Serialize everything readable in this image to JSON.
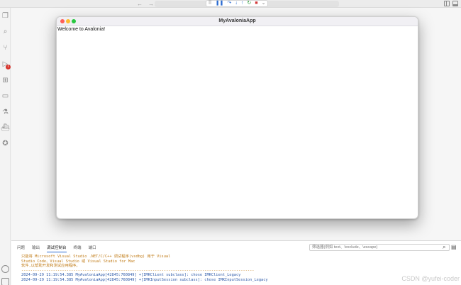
{
  "topbar": {
    "back_arrow": "←",
    "forward_arrow": "→",
    "debug_controls": [
      {
        "icon": "drag-handle-icon",
        "glyph": "⠿"
      },
      {
        "icon": "pause-icon",
        "glyph": "❚❚"
      },
      {
        "icon": "step-over-icon",
        "glyph": "↷"
      },
      {
        "icon": "step-into-icon",
        "glyph": "↓"
      },
      {
        "icon": "step-out-icon",
        "glyph": "↑"
      },
      {
        "icon": "restart-icon",
        "glyph": "↻"
      },
      {
        "icon": "stop-icon",
        "glyph": "■"
      },
      {
        "icon": "chevron-down-icon",
        "glyph": "⌄"
      }
    ]
  },
  "activity": [
    {
      "name": "explorer-icon",
      "glyph": "❐"
    },
    {
      "name": "search-icon",
      "glyph": "⌕"
    },
    {
      "name": "source-control-icon",
      "glyph": "⑂"
    },
    {
      "name": "run-debug-icon",
      "glyph": "▷",
      "badge": "1"
    },
    {
      "name": "extensions-icon",
      "glyph": "⊞"
    },
    {
      "name": "remote-explorer-icon",
      "glyph": "▭"
    },
    {
      "name": "testing-icon",
      "glyph": "⚗"
    },
    {
      "name": "docker-icon",
      "glyph": "⛴"
    },
    {
      "name": "gitlens-icon",
      "glyph": "✪"
    }
  ],
  "app_window": {
    "title": "MyAvaloniaApp",
    "welcome_text": "Welcome to Avalonia!"
  },
  "panel": {
    "tabs": [
      "问题",
      "输出",
      "调试控制台",
      "终端",
      "端口"
    ],
    "active_tab": "调试控制台",
    "filter_placeholder": "筛选器(例如 text、!exclude、\\escape)",
    "console_lines": [
      {
        "kind": "warn",
        "text": "只能将 Microsoft Visual Studio .NET/C/C++ 调试程序(vsdbg) 用于 Visual"
      },
      {
        "kind": "warn",
        "text": "Studio Code、Visual Studio 或 Visual Studio for Mac"
      },
      {
        "kind": "warn",
        "text": "软件,以帮助开发和测试应用程序。"
      },
      {
        "kind": "sep",
        "text": "-------------------------------------------------------------------------------------------------------"
      },
      {
        "kind": "info",
        "text": "2024-09-29 11:19:54.385 MyAvaloniaApp[42845:760849] +[IMKClient subclass]: chose IMKClient_Legacy"
      },
      {
        "kind": "info",
        "text": "2024-09-29 11:19:54.385 MyAvaloniaApp[42845:760849] +[IMKInputSession subclass]: chose IMKInputSession_Legacy"
      }
    ]
  },
  "watermark": "CSDN @yufei-coder",
  "colors": {
    "badge": "#d7322a",
    "close": "#fe5f57",
    "minimize": "#febc2e",
    "maximize": "#28c840",
    "console_warn": "#c07a14",
    "console_info": "#2b58a8"
  }
}
